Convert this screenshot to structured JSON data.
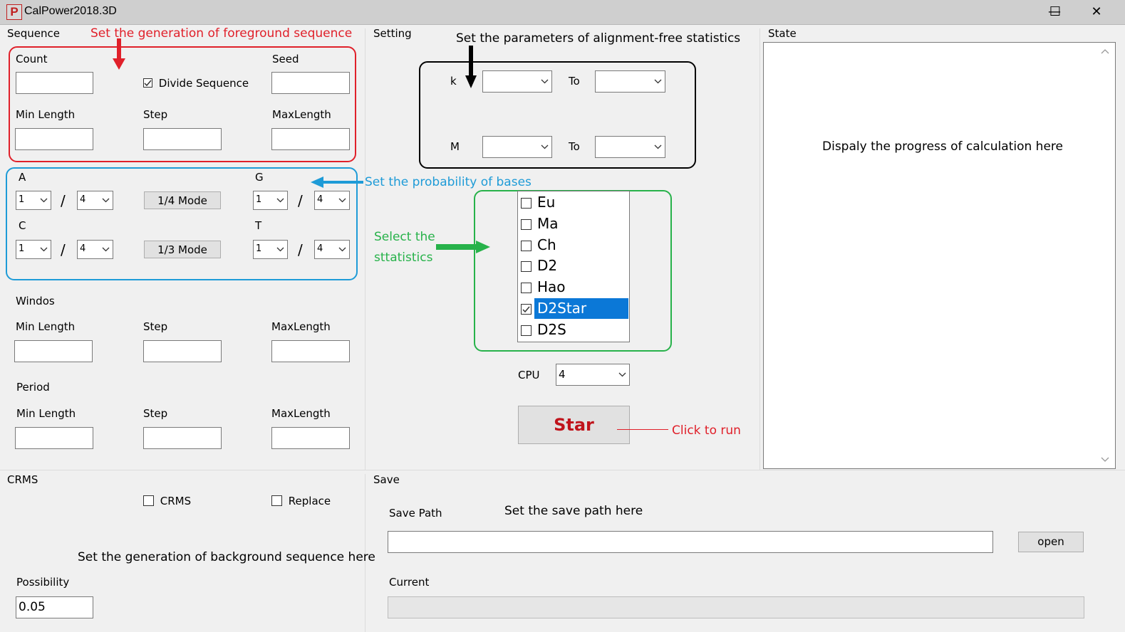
{
  "window": {
    "title": "CalPower2018.3D",
    "app_icon": "P",
    "minimize": "—",
    "maximize": "☐",
    "close": "✕"
  },
  "sequence": {
    "group_label": "Sequence",
    "count_label": "Count",
    "seed_label": "Seed",
    "divide_label": "Divide Sequence",
    "divide_checked": true,
    "min_length_label": "Min Length",
    "step_label": "Step",
    "max_length_label": "MaxLength",
    "count": "",
    "seed": "",
    "min_length": "",
    "step": "",
    "max_length": ""
  },
  "bases": {
    "a_label": "A",
    "g_label": "G",
    "c_label": "C",
    "t_label": "T",
    "slash": "/",
    "a_num": "1",
    "a_den": "4",
    "g_num": "1",
    "g_den": "4",
    "c_num": "1",
    "c_den": "4",
    "t_num": "1",
    "t_den": "4",
    "quarter_mode": "1/4 Mode",
    "third_mode": "1/3 Mode"
  },
  "windows": {
    "group_label": "Windos",
    "min_length_label": "Min Length",
    "step_label": "Step",
    "max_length_label": "MaxLength"
  },
  "period": {
    "group_label": "Period",
    "min_length_label": "Min Length",
    "step_label": "Step",
    "max_length_label": "MaxLength"
  },
  "crms": {
    "group_label": "CRMS",
    "crms_label": "CRMS",
    "replace_label": "Replace",
    "possibility_label": "Possibility",
    "possibility": "0.05"
  },
  "setting": {
    "group_label": "Setting",
    "k_label": "k",
    "m_label": "M",
    "to_label": "To",
    "statistics": [
      {
        "label": "Eu",
        "checked": false,
        "selected": false
      },
      {
        "label": "Ma",
        "checked": false,
        "selected": false
      },
      {
        "label": "Ch",
        "checked": false,
        "selected": false
      },
      {
        "label": "D2",
        "checked": false,
        "selected": false
      },
      {
        "label": "Hao",
        "checked": false,
        "selected": false
      },
      {
        "label": "D2Star",
        "checked": true,
        "selected": true
      },
      {
        "label": "D2S",
        "checked": false,
        "selected": false
      }
    ],
    "cpu_label": "CPU",
    "cpu_value": "4",
    "run_button": "Star"
  },
  "state": {
    "group_label": "State"
  },
  "save": {
    "group_label": "Save",
    "save_path_label": "Save Path",
    "open_button": "open",
    "current_label": "Current",
    "save_path": ""
  },
  "annotations": {
    "foreground": "Set the generation of foreground sequence",
    "alignment": "Set the parameters of  alignment-free statistics",
    "bases": "Set the probability of bases",
    "select_line1": "Select the",
    "select_line2": "sttatistics",
    "progress": "Dispaly the progress of calculation here",
    "click_run": "Click to run",
    "save_path": "Set the save path here",
    "background": "Set the generation of background  sequence here"
  },
  "colors": {
    "red": "#e0202a",
    "blue": "#1e9bd7",
    "green": "#27b24a",
    "black": "#000000",
    "selection": "#0b78d7",
    "run_text": "#c0141c"
  }
}
